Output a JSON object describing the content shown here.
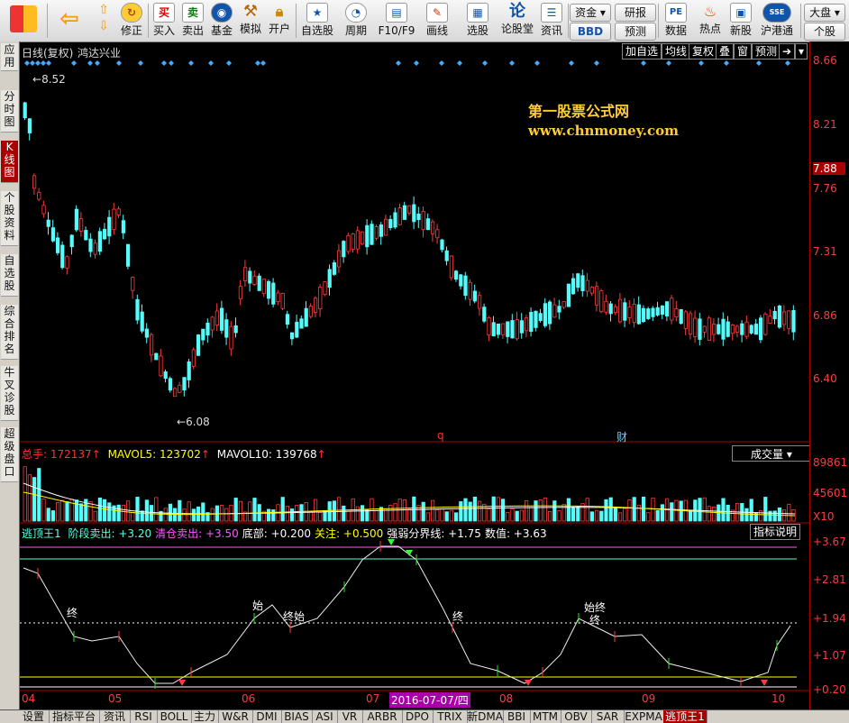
{
  "toolbar": {
    "items": [
      {
        "label": "",
        "icon": "grid-icon"
      },
      {
        "label": "",
        "icon": "back-arrow-icon"
      },
      {
        "label": "修正",
        "icon": "refresh-icon"
      },
      {
        "label": "买入",
        "icon": "buy-icon",
        "glyph": "买"
      },
      {
        "label": "卖出",
        "icon": "sell-icon",
        "glyph": "卖"
      },
      {
        "label": "基金",
        "icon": "fund-icon"
      },
      {
        "label": "模拟",
        "icon": "hammer-icon"
      },
      {
        "label": "开户",
        "icon": "lock-icon"
      },
      {
        "label": "自选股",
        "icon": "star-icon"
      },
      {
        "label": "周期",
        "icon": "clock-icon"
      },
      {
        "label": "F10/F9",
        "icon": "f10-icon"
      },
      {
        "label": "画线",
        "icon": "pencil-icon"
      },
      {
        "label": "选股",
        "icon": "screen-icon"
      },
      {
        "label": "论股堂",
        "icon": "forum-icon",
        "glyph": "论"
      },
      {
        "label": "资讯",
        "icon": "news-icon"
      }
    ],
    "pills": [
      "资金",
      "BBD",
      "研报",
      "预测"
    ],
    "items2": [
      {
        "label": "数据",
        "icon": "pe-icon",
        "glyph": "PE"
      },
      {
        "label": "热点",
        "icon": "hot-icon"
      },
      {
        "label": "新股",
        "icon": "newstock-icon"
      },
      {
        "label": "沪港通",
        "icon": "sse-hkex-icon"
      }
    ],
    "right_pills": [
      "大盘",
      "个股"
    ]
  },
  "sidebar": {
    "tabs": [
      "应用",
      "分时图",
      "K线图",
      "个股资料",
      "自选股",
      "综合排名",
      "牛叉诊股",
      "超级盘口"
    ],
    "active": 2
  },
  "header": {
    "title": "日线(复权)",
    "stock": "鸿达兴业",
    "buttons": [
      "加自选",
      "均线",
      "复权",
      "叠",
      "窗",
      "预测"
    ]
  },
  "watermark": {
    "line1": "第一股票公式网",
    "line2": "www.chnmoney.com"
  },
  "price_axis": {
    "labels": [
      "8.66",
      "8.21",
      "7.76",
      "7.31",
      "6.86",
      "6.40"
    ],
    "current": "7.88"
  },
  "annotations": {
    "high": "8.52",
    "low": "6.08",
    "mark_q": "q",
    "mark_cai": "财"
  },
  "volume": {
    "label_total": "总手:",
    "total": "172137",
    "ma5_label": "MAVOL5:",
    "ma5": "123702",
    "ma10_label": "MAVOL10:",
    "ma10": "139768",
    "selector": "成交量",
    "axis": [
      "89861",
      "45601",
      "X10"
    ]
  },
  "indicator": {
    "name": "逃顶王1",
    "items": [
      {
        "text": "阶段卖出: +3.20",
        "color": "#5fd"
      },
      {
        "text": "清仓卖出: +3.50",
        "color": "#f5f"
      },
      {
        "text": "底部: +0.200",
        "color": "#fff"
      },
      {
        "text": "关注: +0.500",
        "color": "#ff0"
      },
      {
        "text": "强弱分界线: +1.75",
        "color": "#fff"
      },
      {
        "text": "数值: +3.63",
        "color": "#fff"
      }
    ],
    "explain": "指标说明",
    "axis": [
      "3.67",
      "2.81",
      "1.94",
      "1.07",
      "0.20"
    ],
    "tags": [
      "终",
      "始",
      "终始",
      "终",
      "始终",
      "终"
    ]
  },
  "date_axis": {
    "labels": [
      "04",
      "05",
      "06",
      "07",
      "08",
      "09",
      "10"
    ],
    "cursor": "2016-07-07/四"
  },
  "bottom_tabs": [
    "设置",
    "指标平台",
    "资讯",
    "RSI",
    "BOLL",
    "主力",
    "W&R",
    "DMI",
    "BIAS",
    "ASI",
    "VR",
    "ARBR",
    "DPO",
    "TRIX",
    "新DMA",
    "BBI",
    "MTM",
    "OBV",
    "SAR",
    "EXPMA",
    "逃顶王1"
  ],
  "colors": {
    "up": "#ff3b3b",
    "down": "#54fcfc",
    "frame": "#aa0000",
    "axis_text": "#ff3b3b",
    "accent": "#ffcc33"
  }
}
